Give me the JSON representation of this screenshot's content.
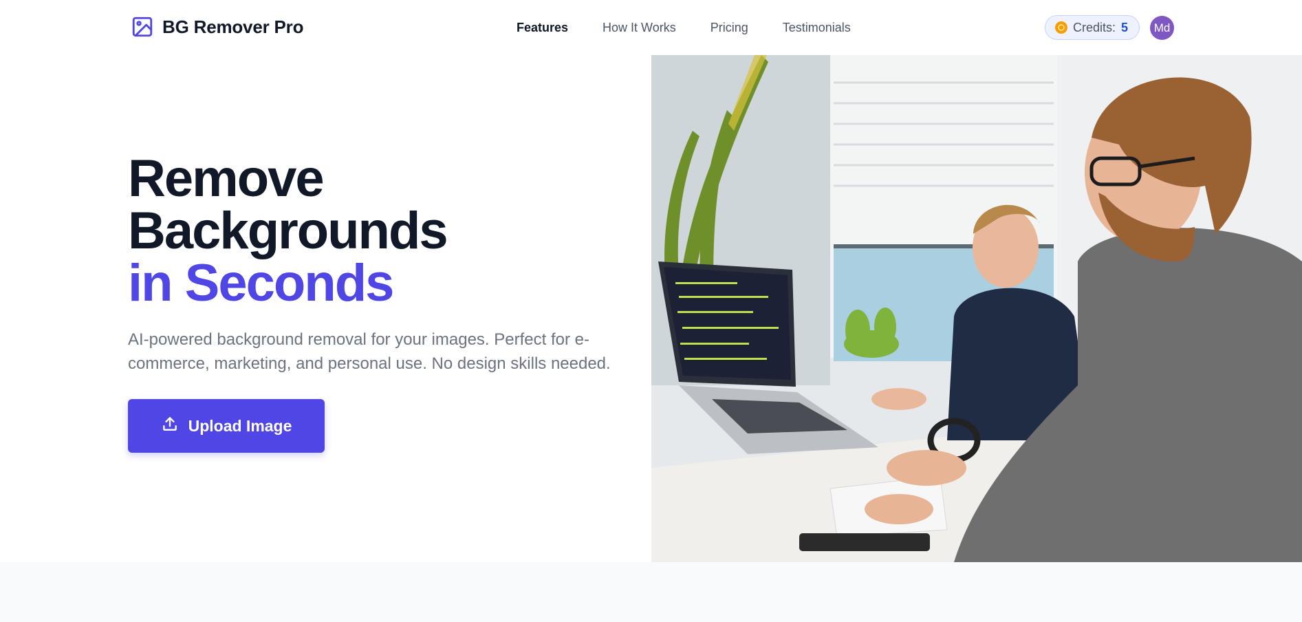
{
  "brand": {
    "name": "BG Remover Pro",
    "icon": "image-icon"
  },
  "nav": {
    "items": [
      {
        "label": "Features",
        "active": true
      },
      {
        "label": "How It Works",
        "active": false
      },
      {
        "label": "Pricing",
        "active": false
      },
      {
        "label": "Testimonials",
        "active": false
      }
    ]
  },
  "account": {
    "credits_label": "Credits:",
    "credits_value": "5",
    "coin_icon": "coin-icon",
    "avatar_initials": "Md"
  },
  "hero": {
    "title_line1": "Remove",
    "title_line2": "Backgrounds",
    "title_line3": "in Seconds",
    "subtitle": "AI-powered background removal for your images. Perfect for e-commerce, marketing, and personal use. No design skills needed.",
    "upload_label": "Upload Image",
    "upload_icon": "upload-icon"
  },
  "colors": {
    "accent": "#4f46e5",
    "text_dark": "#111827",
    "text_muted": "#6b7280",
    "avatar_bg": "#7e57c2",
    "credits_bg": "#eef2ff"
  }
}
